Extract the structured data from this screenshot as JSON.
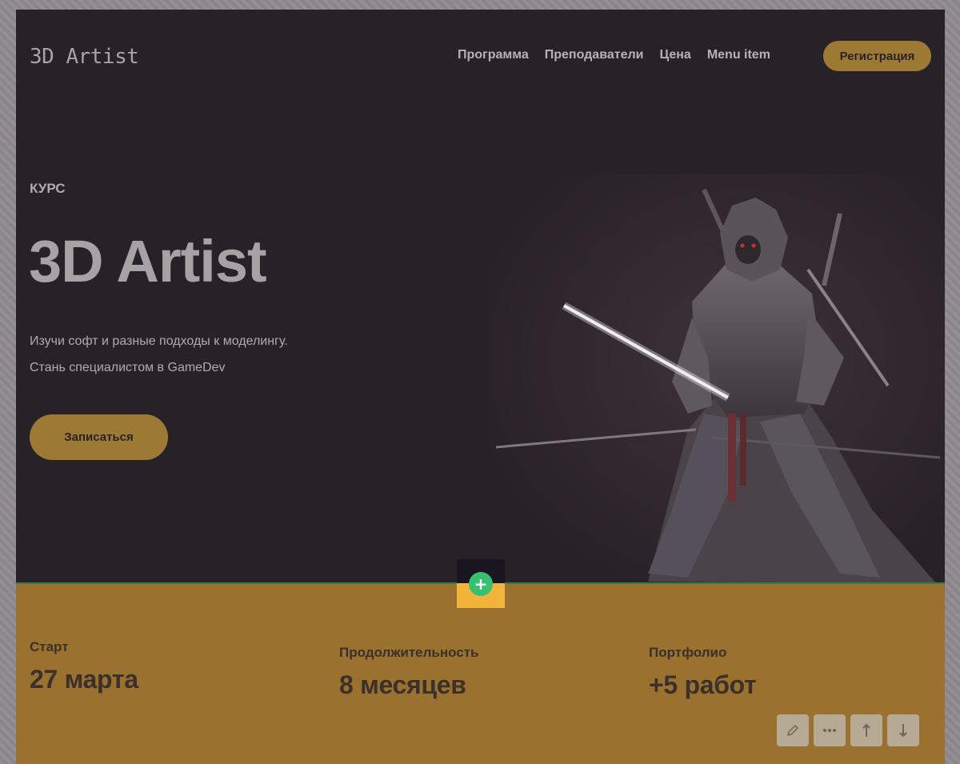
{
  "header": {
    "logo": "3D Artist",
    "nav": [
      "Программа",
      "Преподаватели",
      "Цена",
      "Menu item"
    ],
    "register_label": "Регистрация"
  },
  "hero": {
    "eyebrow": "КУРС",
    "title": "3D Artist",
    "subtitle_line1": "Изучи софт и разные подходы к моделингу.",
    "subtitle_line2": "Стань специалистом в GameDev",
    "cta_label": "Записаться"
  },
  "editor": {
    "add_block_symbol": "+",
    "toolbar_icons": [
      "pencil-icon",
      "more-icon",
      "arrow-up-icon",
      "arrow-down-icon"
    ]
  },
  "stats": [
    {
      "label": "Старт",
      "value": "27 марта"
    },
    {
      "label": "Продолжительность",
      "value": "8 месяцев"
    },
    {
      "label": "Портфолио",
      "value": "+5 работ"
    }
  ],
  "colors": {
    "hero_bg": "#292128",
    "accent": "#9c7a33",
    "stats_bg": "#9a712e",
    "add_button": "#37c06f"
  }
}
